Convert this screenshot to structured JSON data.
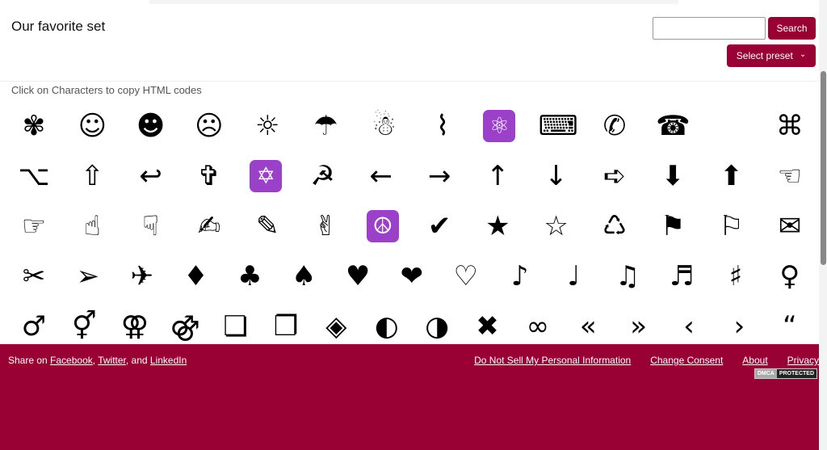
{
  "header": {
    "title": "Our favorite set",
    "search_placeholder": "",
    "search_label": "Search",
    "preset_label": "Select preset",
    "preset_chevron": "⌄"
  },
  "hint": "Click on Characters to copy HTML codes",
  "rows": [
    [
      "✾",
      "☺",
      "☻",
      "☹",
      "☼",
      "☂",
      "☃",
      "⌇",
      "⚛",
      "⌨",
      "✆",
      "☎",
      "",
      "⌘"
    ],
    [
      "⌥",
      "⇧",
      "↩",
      "✞",
      "✡",
      "☭",
      "←",
      "→",
      "↑",
      "↓",
      "➪",
      "⬇",
      "⬆",
      "☜"
    ],
    [
      "☞",
      "☝",
      "☟",
      "✍",
      "✎",
      "✌",
      "☮",
      "✔",
      "★",
      "☆",
      "♺",
      "⚑",
      "⚐",
      "✉"
    ],
    [
      "✂",
      "➢",
      "✈",
      "♦",
      "♣",
      "♠",
      "♥",
      "❤",
      "♡",
      "♪",
      "♩",
      "♫",
      "♬",
      "♯",
      "♀"
    ],
    [
      "♂",
      "⚥",
      "⚢",
      "⚣",
      "❏",
      "❐",
      "◈",
      "◐",
      "◑",
      "✖",
      "∞",
      "«",
      "»",
      "‹",
      "›",
      "“"
    ]
  ],
  "emoji_chars": [
    "⚛",
    "✡",
    "☮"
  ],
  "footer": {
    "share_prefix": "Share on ",
    "facebook": "Facebook",
    "sep1": ", ",
    "twitter": "Twitter",
    "sep2": ", and ",
    "linkedin": "LinkedIn",
    "links": [
      "Do Not Sell My Personal Information",
      "Change Consent",
      "About",
      "Privacy"
    ],
    "dmca_left": "DMCA",
    "dmca_right": "PROTECTED"
  },
  "colors": {
    "brand": "#990033",
    "emoji_bg": "#9b40c8"
  }
}
